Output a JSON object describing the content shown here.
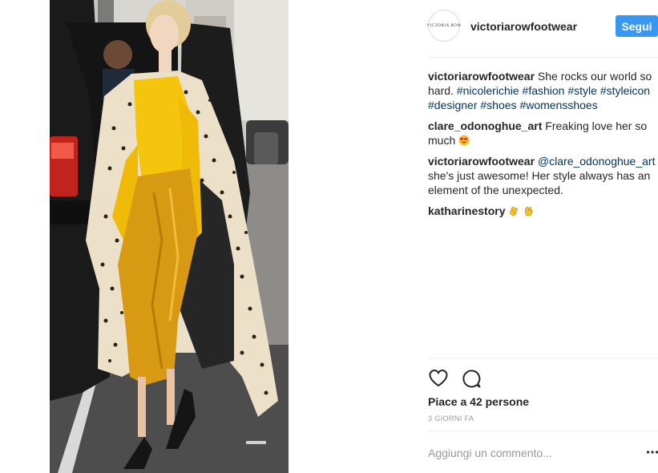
{
  "post": {
    "account": {
      "avatar_text": "VICTORIA ROW",
      "username": "victoriarowfootwear",
      "follow_label": "Segui"
    },
    "comments": [
      {
        "user": "victoriarowfootwear",
        "text": "She rocks our world so hard.",
        "hashtags": [
          "#nicolerichie",
          "#fashion",
          "#style",
          "#styleicon",
          "#designer",
          "#shoes",
          "#womensshoes"
        ]
      },
      {
        "user": "clare_odonoghue_art",
        "text": "Freaking love her so much",
        "emoji": "heart-eyes-emoji"
      },
      {
        "user": "victoriarowfootwear",
        "mention": "@clare_odonoghue_art",
        "text": "she's just awesome! Her style always has an element of the unexpected."
      },
      {
        "user": "katharinestory",
        "emoji": [
          "clapping-hands-emoji",
          "ok-hand-emoji"
        ]
      }
    ],
    "actions": {
      "like_icon": "heart-icon",
      "comment_icon": "comment-bubble-icon"
    },
    "likes_text": "Piace a 42 persone",
    "time_text": "3 GIORNI FA",
    "comment_placeholder": "Aggiungi un commento...",
    "more_icon": "ellipsis-icon"
  }
}
